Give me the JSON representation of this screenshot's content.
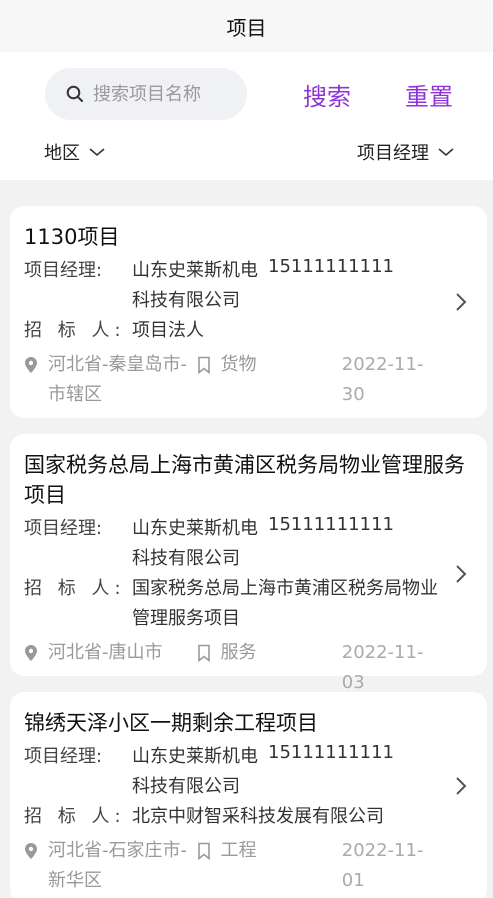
{
  "header": {
    "title": "项目"
  },
  "search": {
    "placeholder": "搜索项目名称",
    "search_label": "搜索",
    "reset_label": "重置"
  },
  "filters": {
    "region_label": "地区",
    "manager_label": "项目经理"
  },
  "labels": {
    "manager": "项目经理:",
    "bidder": "招 标 人:"
  },
  "colors": {
    "accent": "#8e34d8"
  },
  "projects": [
    {
      "title": "1130项目",
      "manager_company": "山东史莱斯机电科技有限公司",
      "manager_phone": "15111111111",
      "bidder": "项目法人",
      "location": "河北省-秦皇岛市-市辖区",
      "category": "货物",
      "date": "2022-11-30"
    },
    {
      "title": "国家税务总局上海市黄浦区税务局物业管理服务项目",
      "manager_company": "山东史莱斯机电科技有限公司",
      "manager_phone": "15111111111",
      "bidder": "国家税务总局上海市黄浦区税务局物业管理服务项目",
      "location": "河北省-唐山市",
      "category": "服务",
      "date": "2022-11-03"
    },
    {
      "title": "锦绣天泽小区一期剩余工程项目",
      "manager_company": "山东史莱斯机电科技有限公司",
      "manager_phone": "15111111111",
      "bidder": "北京中财智采科技发展有限公司",
      "location": "河北省-石家庄市-新华区",
      "category": "工程",
      "date": "2022-11-01"
    }
  ]
}
